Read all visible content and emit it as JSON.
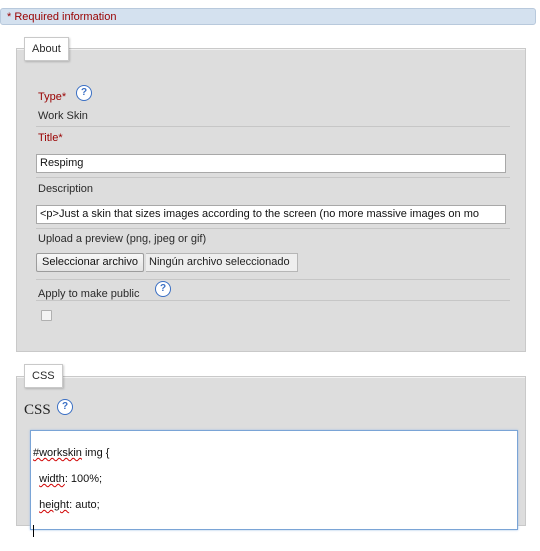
{
  "notice": "* Required information",
  "about": {
    "legend": "About",
    "type_label": "Type",
    "required_mark": "*",
    "help_glyph": "?",
    "type_value": "Work Skin",
    "title_label": "Title",
    "title_value": "Respimg",
    "description_label": "Description",
    "description_value": "<p>Just a skin that sizes images according to the screen (no more massive images on mo",
    "upload_label": "Upload a preview (png, jpeg or gif)",
    "file_button": "Seleccionar archivo",
    "file_status": "Ningún archivo seleccionado",
    "public_label": "Apply to make public",
    "public_checked": false
  },
  "css": {
    "legend": "CSS",
    "heading": "CSS",
    "code_lines": [
      {
        "pre": "",
        "word": "#workskin",
        "post": " img {"
      },
      {
        "pre": "  ",
        "word": "width",
        "post": ": 100%;"
      },
      {
        "pre": "  ",
        "word": "height",
        "post": ": auto;"
      }
    ]
  },
  "colors": {
    "required_red": "#990000",
    "notice_bg": "#d4e1ef",
    "fieldset_bg": "#dddddd",
    "help_blue": "#3a6fc4"
  }
}
